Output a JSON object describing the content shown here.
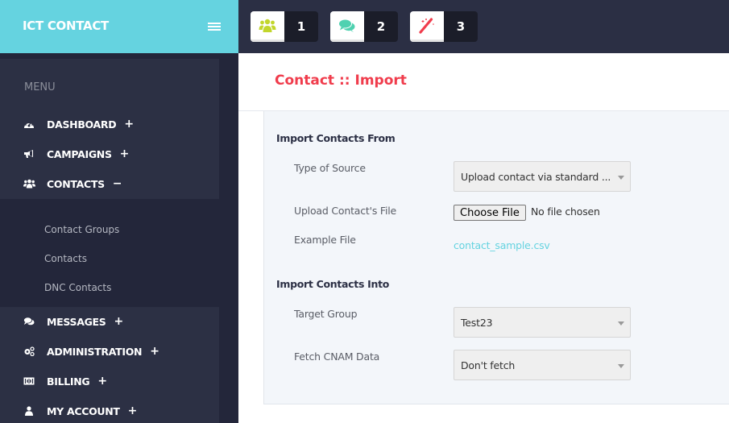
{
  "app": {
    "brand": "ICT CONTACT"
  },
  "topbar": {
    "badges": [
      {
        "icon": "users-icon",
        "count": "1",
        "color": "#c2d62b"
      },
      {
        "icon": "comments-icon",
        "count": "2",
        "color": "#4fd1b0"
      },
      {
        "icon": "magic-wand-icon",
        "count": "3",
        "color": "#f03c4c"
      }
    ]
  },
  "sidebar": {
    "menu_title": "MENU",
    "items": [
      {
        "label": "DASHBOARD",
        "icon": "dashboard-icon",
        "toggle": "+"
      },
      {
        "label": "CAMPAIGNS",
        "icon": "bullhorn-icon",
        "toggle": "+"
      },
      {
        "label": "CONTACTS",
        "icon": "users-icon",
        "toggle": "−"
      },
      {
        "label": "MESSAGES",
        "icon": "comments-icon",
        "toggle": "+"
      },
      {
        "label": "ADMINISTRATION",
        "icon": "cogs-icon",
        "toggle": "+"
      },
      {
        "label": "BILLING",
        "icon": "money-icon",
        "toggle": "+"
      },
      {
        "label": "MY ACCOUNT",
        "icon": "user-icon",
        "toggle": "+"
      }
    ],
    "contacts_submenu": [
      "Contact Groups",
      "Contacts",
      "DNC Contacts"
    ]
  },
  "main": {
    "page_title": "Contact :: Import",
    "section_from": "Import Contacts From",
    "section_into": "Import Contacts Into",
    "fields": {
      "source_type": {
        "label": "Type of Source",
        "value": "Upload contact via standard ..."
      },
      "upload_file": {
        "label": "Upload Contact's File",
        "button": "Choose File",
        "status": "No file chosen"
      },
      "example_file": {
        "label": "Example File",
        "link": "contact_sample.csv"
      },
      "target_group": {
        "label": "Target Group",
        "value": "Test23"
      },
      "fetch_cnam": {
        "label": "Fetch CNAM Data",
        "value": "Don't fetch"
      }
    }
  },
  "colors": {
    "brand": "#65d3e0",
    "title_red": "#f03c4c",
    "link": "#65d3e0"
  }
}
